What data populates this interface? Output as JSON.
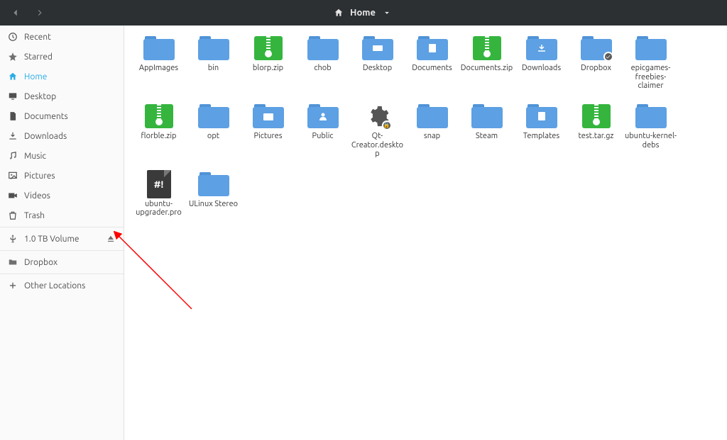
{
  "titlebar": {
    "location": "Home"
  },
  "sidebar": {
    "places": [
      {
        "icon": "recent",
        "label": "Recent"
      },
      {
        "icon": "star",
        "label": "Starred"
      },
      {
        "icon": "home",
        "label": "Home",
        "active": true
      },
      {
        "icon": "desktop",
        "label": "Desktop"
      },
      {
        "icon": "doc",
        "label": "Documents"
      },
      {
        "icon": "download",
        "label": "Downloads"
      },
      {
        "icon": "music",
        "label": "Music"
      },
      {
        "icon": "pictures",
        "label": "Pictures"
      },
      {
        "icon": "videos",
        "label": "Videos"
      },
      {
        "icon": "trash",
        "label": "Trash"
      }
    ],
    "devices": [
      {
        "icon": "usb",
        "label": "1.0 TB Volume",
        "eject": true
      }
    ],
    "bookmarks": [
      {
        "icon": "folder",
        "label": "Dropbox"
      }
    ],
    "other": [
      {
        "icon": "plus",
        "label": "Other Locations"
      }
    ]
  },
  "files": [
    {
      "name": "AppImages",
      "kind": "folder"
    },
    {
      "name": "bin",
      "kind": "folder"
    },
    {
      "name": "blorp.zip",
      "kind": "zip"
    },
    {
      "name": "chob",
      "kind": "folder"
    },
    {
      "name": "Desktop",
      "kind": "folder",
      "glyph": "desktop"
    },
    {
      "name": "Documents",
      "kind": "folder",
      "glyph": "doc"
    },
    {
      "name": "Documents.zip",
      "kind": "zip"
    },
    {
      "name": "Downloads",
      "kind": "folder",
      "glyph": "download"
    },
    {
      "name": "Dropbox",
      "kind": "folder",
      "badge": "check"
    },
    {
      "name": "epicgames-freebies-claimer",
      "kind": "folder"
    },
    {
      "name": "florble.zip",
      "kind": "zip"
    },
    {
      "name": "opt",
      "kind": "folder"
    },
    {
      "name": "Pictures",
      "kind": "folder",
      "glyph": "pictures"
    },
    {
      "name": "Public",
      "kind": "folder",
      "glyph": "public"
    },
    {
      "name": "Qt-Creator.desktop",
      "kind": "gear",
      "badge": "lock"
    },
    {
      "name": "snap",
      "kind": "folder"
    },
    {
      "name": "Steam",
      "kind": "folder"
    },
    {
      "name": "Templates",
      "kind": "folder",
      "glyph": "templates"
    },
    {
      "name": "test.tar.gz",
      "kind": "zip"
    },
    {
      "name": "ubuntu-kernel-debs",
      "kind": "folder"
    },
    {
      "name": "ubuntu-upgrader.pro",
      "kind": "proj"
    },
    {
      "name": "ULinux Stereo",
      "kind": "folder"
    }
  ],
  "annotation": {
    "arrow": true
  }
}
